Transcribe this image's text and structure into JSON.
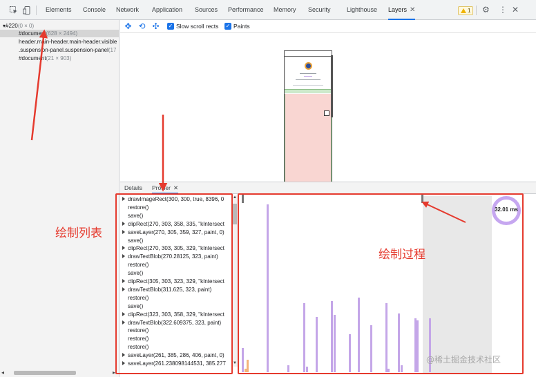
{
  "toolbar": {
    "tabs": [
      "Elements",
      "Console",
      "Network",
      "Application",
      "Sources",
      "Performance",
      "Memory",
      "Security",
      "Lighthouse",
      "Layers"
    ],
    "active_tab": "Layers",
    "close_glyph": "✕",
    "warning_count": "1",
    "icons": [
      "inspect-element-icon",
      "device-toggle-icon",
      "gear-icon",
      "more-vertical-icon",
      "close-icon"
    ]
  },
  "layer_tree": {
    "root": "#220",
    "root_size": "(0 × 0)",
    "items": [
      {
        "label": "#document",
        "size": "(628 × 2494)"
      },
      {
        "label": "header.main-header.main-header.visible",
        "size": ""
      },
      {
        "label": ".suspension-panel.suspension-panel",
        "size": "(17"
      },
      {
        "label": "#document",
        "size": "(21 × 903)"
      }
    ]
  },
  "layers_toolbar": {
    "slow_scroll_label": "Slow scroll rects",
    "slow_scroll_checked": true,
    "paints_label": "Paints",
    "paints_checked": true
  },
  "detail_tabs": {
    "details": "Details",
    "profiler": "Profiler",
    "active": "Profiler"
  },
  "commands": [
    {
      "text": "drawImageRect(300, 300, true, 8396, 0",
      "expandable": true
    },
    {
      "text": "restore()",
      "expandable": false
    },
    {
      "text": "save()",
      "expandable": false
    },
    {
      "text": "clipRect(270, 303, 358, 335, \"kIntersect",
      "expandable": true
    },
    {
      "text": "saveLayer(270, 305, 359, 327, paint, 0)",
      "expandable": true
    },
    {
      "text": "save()",
      "expandable": false
    },
    {
      "text": "clipRect(270, 303, 305, 329, \"kIntersect",
      "expandable": true
    },
    {
      "text": "drawTextBlob(270.28125, 323, paint)",
      "expandable": true
    },
    {
      "text": "restore()",
      "expandable": false
    },
    {
      "text": "save()",
      "expandable": false
    },
    {
      "text": "clipRect(305, 303, 323, 329, \"kIntersect",
      "expandable": true
    },
    {
      "text": "drawTextBlob(311.625, 323, paint)",
      "expandable": true
    },
    {
      "text": "restore()",
      "expandable": false
    },
    {
      "text": "save()",
      "expandable": false
    },
    {
      "text": "clipRect(323, 303, 358, 329, \"kIntersect",
      "expandable": true
    },
    {
      "text": "drawTextBlob(322.609375, 323, paint)",
      "expandable": true
    },
    {
      "text": "restore()",
      "expandable": false
    },
    {
      "text": "restore()",
      "expandable": false
    },
    {
      "text": "restore()",
      "expandable": false
    },
    {
      "text": "saveLayer(261, 385, 286, 406, paint, 0)",
      "expandable": true
    },
    {
      "text": "saveLayer(261.238098144531, 385.277",
      "expandable": true
    }
  ],
  "timeline": {
    "total_label": "32.01 ms",
    "bars": [
      {
        "h": 0.14,
        "c": "purple"
      },
      {
        "h": 0.97,
        "c": "purple"
      },
      {
        "h": 0.04,
        "c": "purple"
      },
      {
        "h": 0.4,
        "c": "purple"
      },
      {
        "h": 0.03,
        "c": "purple"
      },
      {
        "h": 0.32,
        "c": "purple"
      },
      {
        "h": 0.41,
        "c": "purple"
      },
      {
        "h": 0.33,
        "c": "purple"
      },
      {
        "h": 0.22,
        "c": "purple"
      },
      {
        "h": 0.43,
        "c": "purple"
      },
      {
        "h": 0.27,
        "c": "purple"
      },
      {
        "h": 0.4,
        "c": "purple"
      },
      {
        "h": 0.02,
        "c": "purple"
      },
      {
        "h": 0.34,
        "c": "purple"
      },
      {
        "h": 0.04,
        "c": "purple"
      },
      {
        "h": 0.31,
        "c": "purple"
      },
      {
        "h": 0.3,
        "c": "purple"
      },
      {
        "h": 0.31,
        "c": "purple"
      },
      {
        "h": 0.02,
        "c": "orange"
      },
      {
        "h": 0.07,
        "c": "orange"
      }
    ]
  },
  "annotations": {
    "command_list_label": "绘制列表",
    "timeline_label": "绘制过程",
    "color": "#e53a2e"
  },
  "watermark": "@稀土掘金技术社区"
}
